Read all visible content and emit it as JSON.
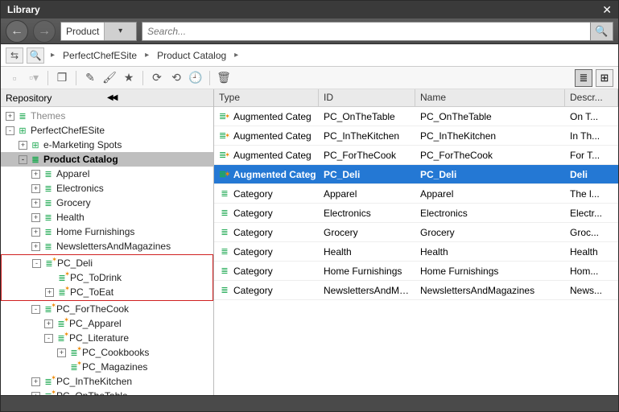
{
  "window": {
    "title": "Library"
  },
  "nav": {
    "combo_value": "Product",
    "search_placeholder": "Search..."
  },
  "breadcrumb": {
    "items": [
      "PerfectChefESite",
      "Product Catalog"
    ]
  },
  "repo": {
    "header": "Repository"
  },
  "tree": [
    {
      "depth": 0,
      "toggle": "+",
      "icon": "≣",
      "label": "Themes",
      "dim": true
    },
    {
      "depth": 0,
      "toggle": "-",
      "icon": "⊞",
      "label": "PerfectChefESite"
    },
    {
      "depth": 1,
      "toggle": "+",
      "icon": "⊞",
      "label": "e-Marketing Spots"
    },
    {
      "depth": 1,
      "toggle": "-",
      "icon": "≣",
      "label": "Product Catalog",
      "selected": true
    },
    {
      "depth": 2,
      "toggle": "+",
      "icon": "≣",
      "label": "Apparel"
    },
    {
      "depth": 2,
      "toggle": "+",
      "icon": "≣",
      "label": "Electronics"
    },
    {
      "depth": 2,
      "toggle": "+",
      "icon": "≣",
      "label": "Grocery"
    },
    {
      "depth": 2,
      "toggle": "+",
      "icon": "≣",
      "label": "Health"
    },
    {
      "depth": 2,
      "toggle": "+",
      "icon": "≣",
      "label": "Home Furnishings"
    },
    {
      "depth": 2,
      "toggle": "+",
      "icon": "≣",
      "label": "NewslettersAndMagazines"
    },
    {
      "depth": 2,
      "toggle": "-",
      "icon": "≣*",
      "label": "PC_Deli",
      "box_start": true
    },
    {
      "depth": 3,
      "toggle": "",
      "icon": "≣*",
      "label": "PC_ToDrink"
    },
    {
      "depth": 3,
      "toggle": "+",
      "icon": "≣*",
      "label": "PC_ToEat",
      "box_end": true
    },
    {
      "depth": 2,
      "toggle": "-",
      "icon": "≣*",
      "label": "PC_ForTheCook"
    },
    {
      "depth": 3,
      "toggle": "+",
      "icon": "≣*",
      "label": "PC_Apparel"
    },
    {
      "depth": 3,
      "toggle": "-",
      "icon": "≣*",
      "label": "PC_Literature"
    },
    {
      "depth": 4,
      "toggle": "+",
      "icon": "≣*",
      "label": "PC_Cookbooks"
    },
    {
      "depth": 4,
      "toggle": "",
      "icon": "≣*",
      "label": "PC_Magazines"
    },
    {
      "depth": 2,
      "toggle": "+",
      "icon": "≣*",
      "label": "PC_InTheKitchen"
    },
    {
      "depth": 2,
      "toggle": "+",
      "icon": "≣*",
      "label": "PC_OnTheTable"
    }
  ],
  "table": {
    "headers": {
      "type": "Type",
      "id": "ID",
      "name": "Name",
      "descr": "Descr..."
    },
    "rows": [
      {
        "icon": "≣*",
        "type": "Augmented Categ",
        "id": "PC_OnTheTable",
        "name": "PC_OnTheTable",
        "descr": "On T..."
      },
      {
        "icon": "≣*",
        "type": "Augmented Categ",
        "id": "PC_InTheKitchen",
        "name": "PC_InTheKitchen",
        "descr": "In Th..."
      },
      {
        "icon": "≣*",
        "type": "Augmented Categ",
        "id": "PC_ForTheCook",
        "name": "PC_ForTheCook",
        "descr": "For T..."
      },
      {
        "icon": "≣*",
        "type": "Augmented Categ",
        "id": "PC_Deli",
        "name": "PC_Deli",
        "descr": "Deli",
        "selected": true
      },
      {
        "icon": "≣",
        "type": "Category",
        "id": "Apparel",
        "name": "Apparel",
        "descr": "The l..."
      },
      {
        "icon": "≣",
        "type": "Category",
        "id": "Electronics",
        "name": "Electronics",
        "descr": "Electr..."
      },
      {
        "icon": "≣",
        "type": "Category",
        "id": "Grocery",
        "name": "Grocery",
        "descr": "Groc..."
      },
      {
        "icon": "≣",
        "type": "Category",
        "id": "Health",
        "name": "Health",
        "descr": "Health"
      },
      {
        "icon": "≣",
        "type": "Category",
        "id": "Home Furnishings",
        "name": "Home Furnishings",
        "descr": "Hom..."
      },
      {
        "icon": "≣",
        "type": "Category",
        "id": "NewslettersAndMa...",
        "name": "NewslettersAndMagazines",
        "descr": "News..."
      }
    ]
  }
}
